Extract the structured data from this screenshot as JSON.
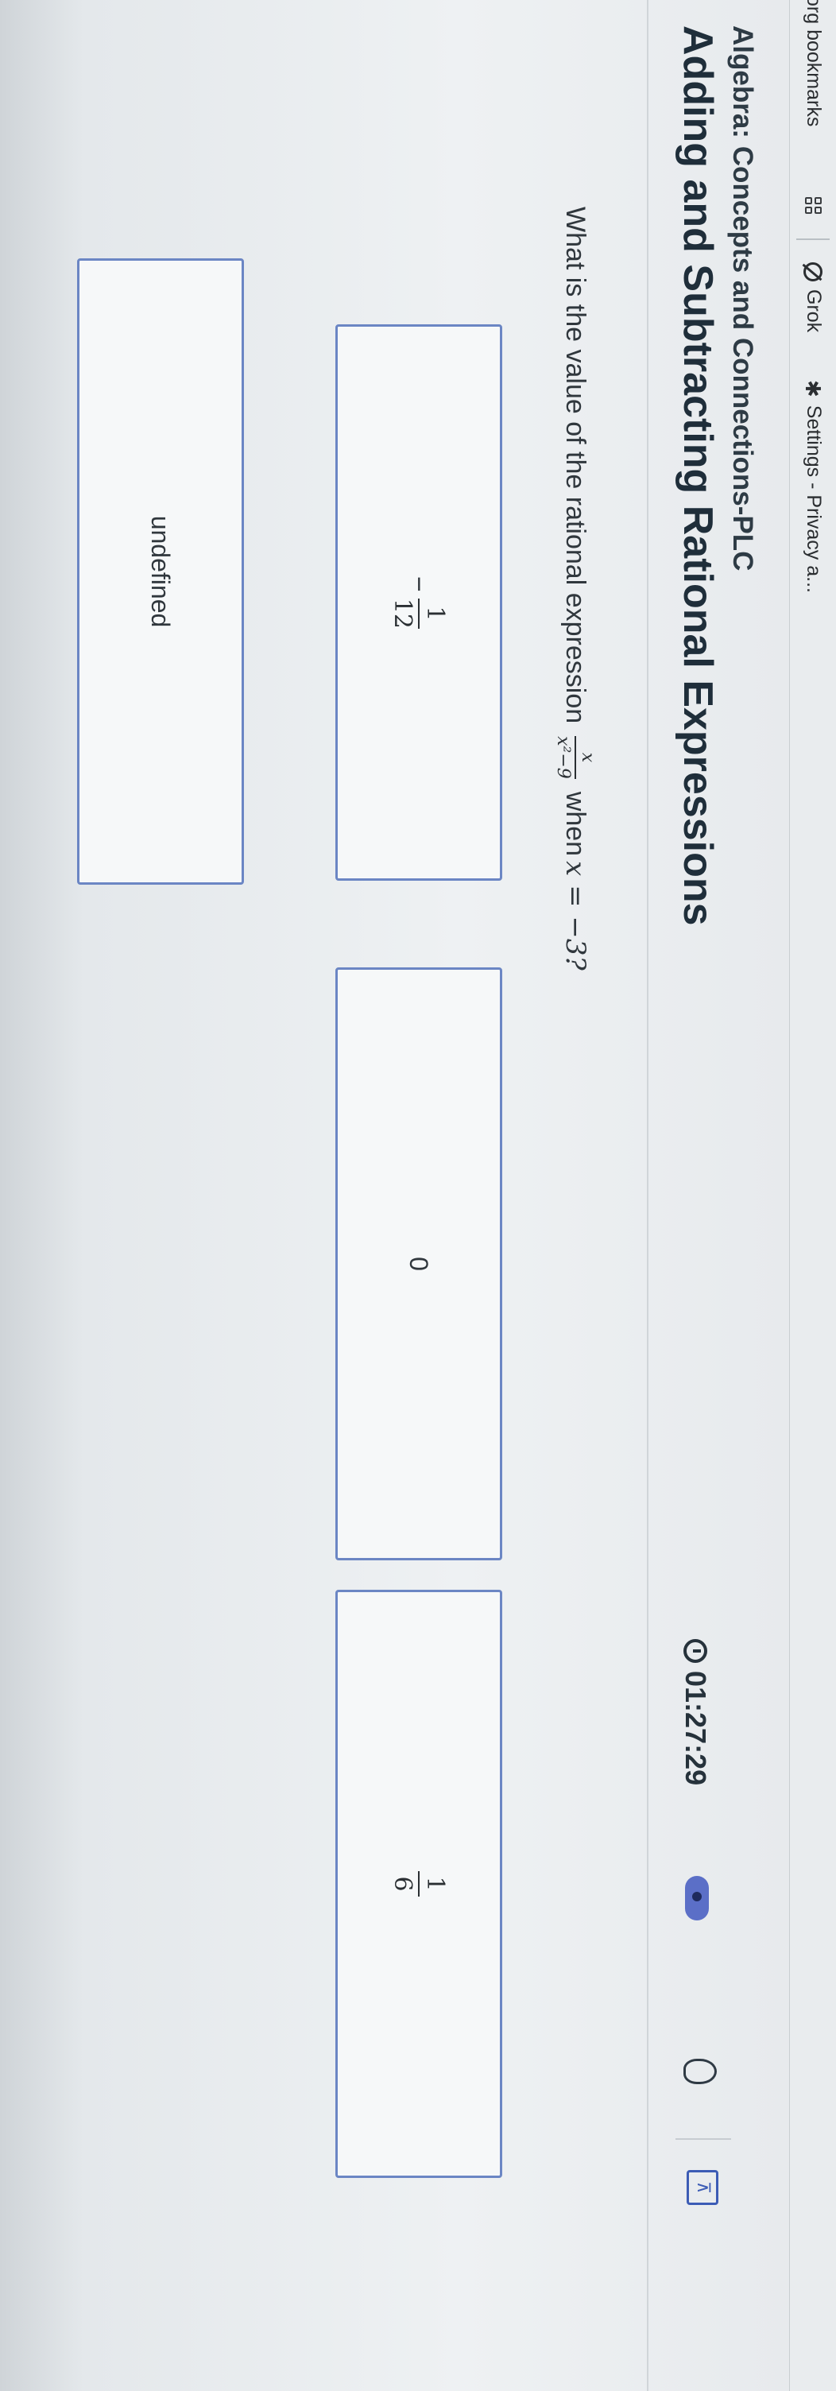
{
  "bookmarks": {
    "items": [
      {
        "label": "org bookmarks"
      },
      {
        "label": "Grok"
      },
      {
        "label": "Settings - Privacy a..."
      }
    ]
  },
  "header": {
    "course": "Algebra: Concepts and Connections-PLC",
    "topic": "Adding and Subtracting Rational Expressions",
    "timer": "01:27:29"
  },
  "question": {
    "prefix": "What is the value of the rational expression",
    "fraction_num": "x",
    "fraction_den": "x²−9",
    "middle": "when",
    "condition": "x = −3?"
  },
  "choices": [
    {
      "sign": "−",
      "num": "1",
      "den": "12"
    },
    {
      "label": "0"
    },
    {
      "num": "1",
      "den": "6"
    },
    {
      "label": "undefined"
    }
  ],
  "colors": {
    "accent": "#5b6fc7",
    "choice_border": "#6b86c4",
    "heading": "#1f2e3a"
  }
}
